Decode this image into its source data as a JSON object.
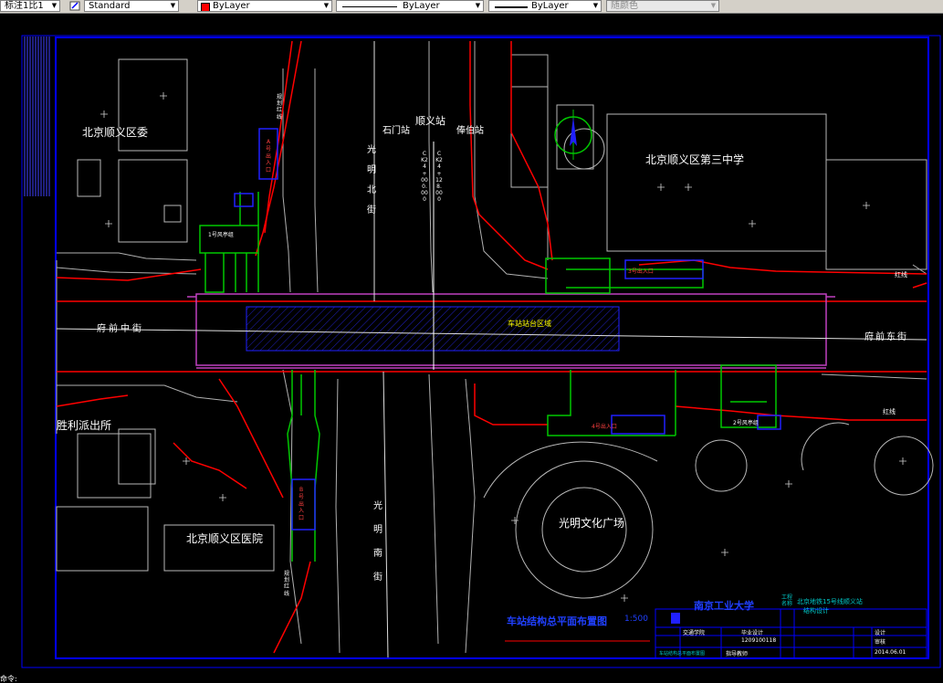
{
  "toolbar": {
    "dimstyle_label": "标注1比1",
    "textstyle_label": "Standard",
    "layer_label": "ByLayer",
    "linetype_label": "ByLayer",
    "lineweight_label": "ByLayer",
    "plotstyle_label": "随颜色",
    "layer_color": "#ff0000"
  },
  "drawing": {
    "title": "车站结构总平面布置图",
    "scale": "1:500",
    "streets": {
      "west": "府前中街",
      "east": "府前东街",
      "north": "光明北街",
      "south": "光明南街"
    },
    "stations": {
      "current": "顺义站",
      "prev": "石门站",
      "next": "俸伯站"
    },
    "buildings": {
      "nw": "北京顺义区委",
      "ne": "北京顺义区第三中学",
      "sw_police": "胜利派出所",
      "sw_hospital": "北京顺义区医院",
      "plaza": "光明文化广场"
    },
    "entrances": {
      "e1": "1号风亭组",
      "e2": "2号风亭组",
      "e3": "3号出入口",
      "e4": "4号出入口",
      "a_vertical": "A号出入口",
      "b_vertical": "B号出入口"
    },
    "station_zone": "车站站台区域",
    "mileage_label": "CK24+000.000",
    "mileage_label2": "CK24+128.000",
    "red_line": "红线",
    "red_line2": "红线",
    "vertical_red_1": "规划红线",
    "vertical_red_2": "规划红线"
  },
  "titleblock": {
    "university": "南京工业大学",
    "project_label": "工程名称",
    "project_name": "北京地铁15号线顺义站",
    "project_sub": "结构设计",
    "row1_left": "交通学院",
    "row1_mid": "毕业设计",
    "row2_mid": "1209100118",
    "row3_left": "车站结构总平面布置图",
    "row3_mid": "指导教师",
    "designer": "设计",
    "checker": "审核",
    "date": "2014.06.01"
  },
  "command": {
    "prompt": "命令:"
  },
  "colors": {
    "border_blue": "#0000ff",
    "red_line": "#ff0000",
    "green": "#00c800",
    "magenta": "#c040c0",
    "cyan": "#00c8c8"
  }
}
